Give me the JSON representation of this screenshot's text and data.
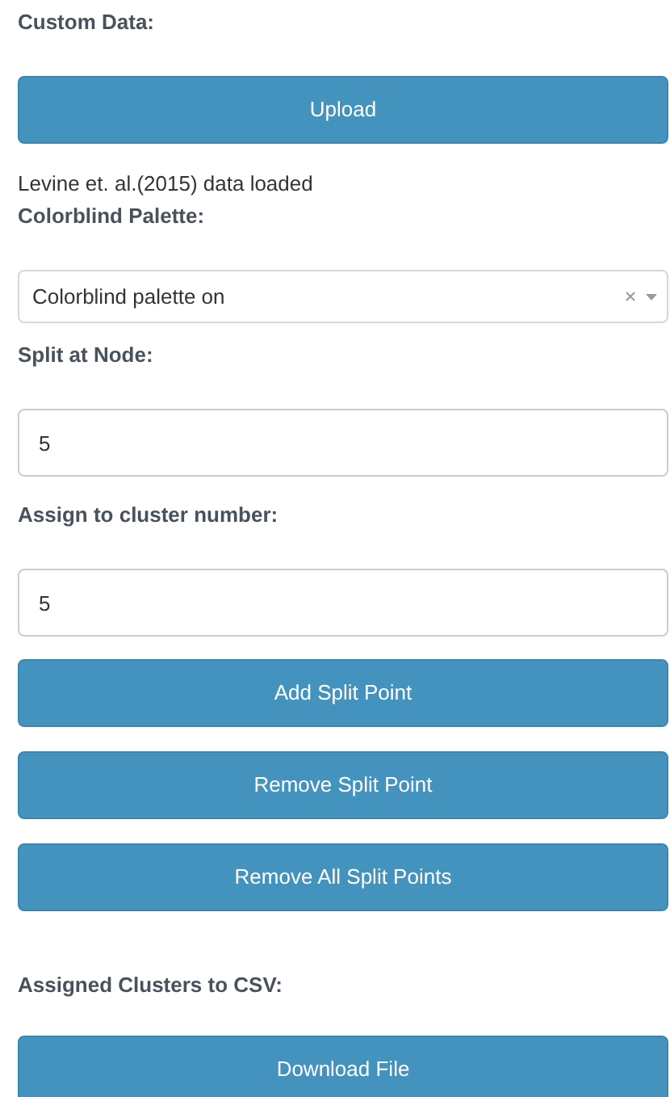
{
  "controls": [
    {
      "kind": "label",
      "text": "Custom Data:"
    },
    {
      "kind": "button",
      "text": "Upload"
    },
    {
      "kind": "text",
      "text": "Levine et. al.(2015) data loaded"
    },
    {
      "kind": "label",
      "text": "Colorblind Palette:"
    },
    {
      "kind": "select",
      "value": "Colorblind palette on"
    },
    {
      "kind": "label",
      "text": "Split at Node:"
    },
    {
      "kind": "input",
      "value": "5"
    },
    {
      "kind": "label",
      "text": "Assign to cluster number:"
    },
    {
      "kind": "input",
      "value": "5"
    },
    {
      "kind": "button",
      "text": "Add Split Point"
    },
    {
      "kind": "button",
      "text": "Remove Split Point"
    },
    {
      "kind": "button",
      "text": "Remove All Split Points"
    },
    {
      "kind": "label",
      "text": "Assigned Clusters to CSV:"
    },
    {
      "kind": "button",
      "text": "Download File"
    }
  ]
}
